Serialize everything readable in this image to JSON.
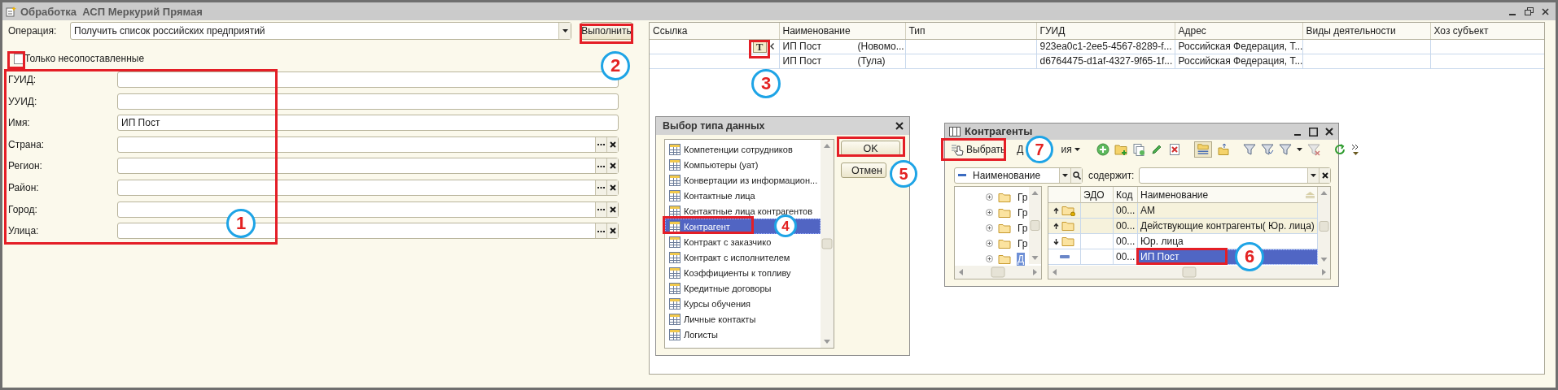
{
  "window": {
    "title": "Обработка  АСП Меркурий Прямая"
  },
  "form": {
    "operation": {
      "label": "Операция:",
      "value": "Получить список российских предприятий"
    },
    "execute_button": "Выполнить",
    "only_unmatched": {
      "label": "Только несопоставленные",
      "checked": false
    },
    "fields": [
      {
        "label": "ГУИД:",
        "kind": "text"
      },
      {
        "label": "УУИД:",
        "kind": "text"
      },
      {
        "label": "Имя:",
        "kind": "text",
        "value": "ИП Пост"
      },
      {
        "label": "Страна:",
        "kind": "reference"
      },
      {
        "label": "Регион:",
        "kind": "reference"
      },
      {
        "label": "Район:",
        "kind": "reference"
      },
      {
        "label": "Город:",
        "kind": "reference"
      },
      {
        "label": "Улица:",
        "kind": "reference"
      }
    ]
  },
  "results": {
    "columns": [
      "Ссылка",
      "Наименование",
      "Тип",
      "ГУИД",
      "Адрес",
      "Виды деятельности",
      "Хоз субъект"
    ],
    "rows": [
      {
        "type_button": "T",
        "name": "ИП Пост",
        "region": "(Новомо...",
        "guid": "923ea0c1-2ee5-4567-8289-f...",
        "address": "Российская Федерация, Т..."
      },
      {
        "name": "ИП Пост",
        "region": "(Тула)",
        "guid": "d6764475-d1af-4327-9f65-1f...",
        "address": "Российская Федерация, Т..."
      }
    ]
  },
  "type_dialog": {
    "title": "Выбор типа данных",
    "ok_button": "OK",
    "cancel_button": "Отмен",
    "items": [
      {
        "label": "Компетенции сотрудников",
        "selected": false
      },
      {
        "label": "Компьютеры (уат)",
        "selected": false
      },
      {
        "label": "Конвертации из информацион...",
        "selected": false
      },
      {
        "label": "Контактные лица",
        "selected": false
      },
      {
        "label": "Контактные лица контрагентов",
        "selected": false
      },
      {
        "label": "Контрагент",
        "selected": true
      },
      {
        "label": "Контракт с заказчико",
        "selected": false
      },
      {
        "label": "Контракт с исполнителем",
        "selected": false
      },
      {
        "label": "Коэффициенты к топливу",
        "selected": false
      },
      {
        "label": "Кредитные договоры",
        "selected": false
      },
      {
        "label": "Курсы обучения",
        "selected": false
      },
      {
        "label": "Личные контакты",
        "selected": false
      },
      {
        "label": "Логисты",
        "selected": false
      }
    ]
  },
  "counterparties": {
    "title": "Контрагенты",
    "select_button": "Выбрать",
    "actions_button": {
      "start": "Д",
      "end": "ия"
    },
    "hierarchy_on": true,
    "filter": {
      "field": "Наименование",
      "condition": "содержит:"
    },
    "tree": [
      {
        "label": "Гр",
        "selected": false
      },
      {
        "label": "Гр",
        "selected": false
      },
      {
        "label": "Гр",
        "selected": false
      },
      {
        "label": "Гр",
        "selected": false
      },
      {
        "label": "Д",
        "selected": true
      }
    ],
    "columns": [
      "ЭДО",
      "Код",
      "Наименование"
    ],
    "rows": [
      {
        "kind": "parent-group",
        "marked": true,
        "code": "00...",
        "name": "АМ",
        "selected": false
      },
      {
        "kind": "parent-group",
        "marked": false,
        "code": "00...",
        "name": "Действующие контрагенты( Юр. лица)",
        "selected": false
      },
      {
        "kind": "current-group",
        "marked": false,
        "code": "00...",
        "name": "Юр. лица",
        "selected": false
      },
      {
        "kind": "item",
        "marked": false,
        "code": "00...",
        "name": "ИП Пост",
        "selected": true
      }
    ]
  },
  "annotations": [
    {
      "number": "1"
    },
    {
      "number": "2"
    },
    {
      "number": "3"
    },
    {
      "number": "4"
    },
    {
      "number": "5"
    },
    {
      "number": "6"
    },
    {
      "number": "7"
    }
  ]
}
